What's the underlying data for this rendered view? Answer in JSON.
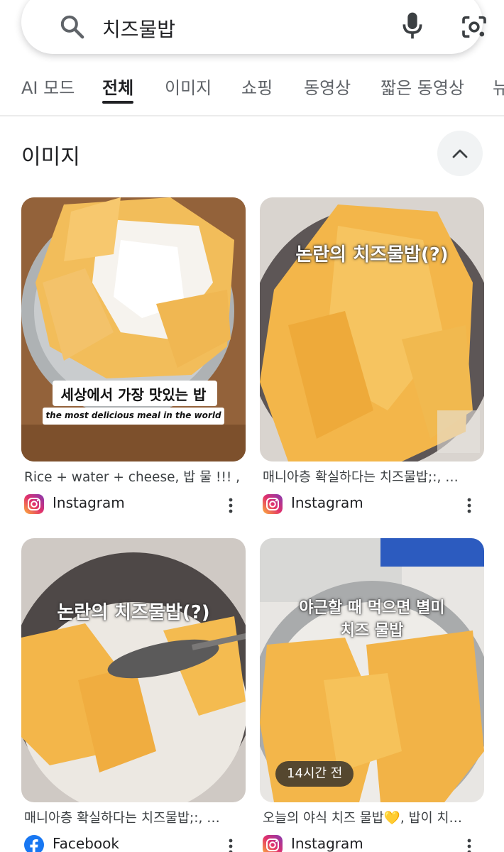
{
  "search": {
    "query": "치즈물밥"
  },
  "tabs": [
    {
      "label": "AI 모드"
    },
    {
      "label": "전체"
    },
    {
      "label": "이미지"
    },
    {
      "label": "쇼핑"
    },
    {
      "label": "동영상"
    },
    {
      "label": "짧은 동영상"
    },
    {
      "label": "뉴"
    }
  ],
  "active_tab": "전체",
  "section": {
    "title": "이미지"
  },
  "results": [
    {
      "caption": "Rice + water + cheese, 밥 물 !!! , …",
      "source": "Instagram",
      "overlay_ko": "세상에서 가장 맛있는 밥",
      "overlay_en": "the most delicious meal in the world"
    },
    {
      "caption": "매니아층 확실하다는 치즈물밥;:, …",
      "source": "Instagram",
      "overlay_ko": "논란의 치즈물밥(?)"
    },
    {
      "caption": "매니아층 확실하다는 치즈물밥;:, …",
      "source": "Facebook",
      "overlay_ko": "논란의 치즈물밥(?)"
    },
    {
      "caption": "오늘의 야식 치즈 물밥💛, 밥이 치…",
      "source": "Instagram",
      "overlay_line1": "야근할 때 먹으면 별미",
      "overlay_line2": "치즈 물밥",
      "time_badge": "14시간 전"
    }
  ],
  "colors": {
    "cheese": "#f3b64a",
    "instagram": "#d6249f",
    "facebook": "#1877f2"
  }
}
